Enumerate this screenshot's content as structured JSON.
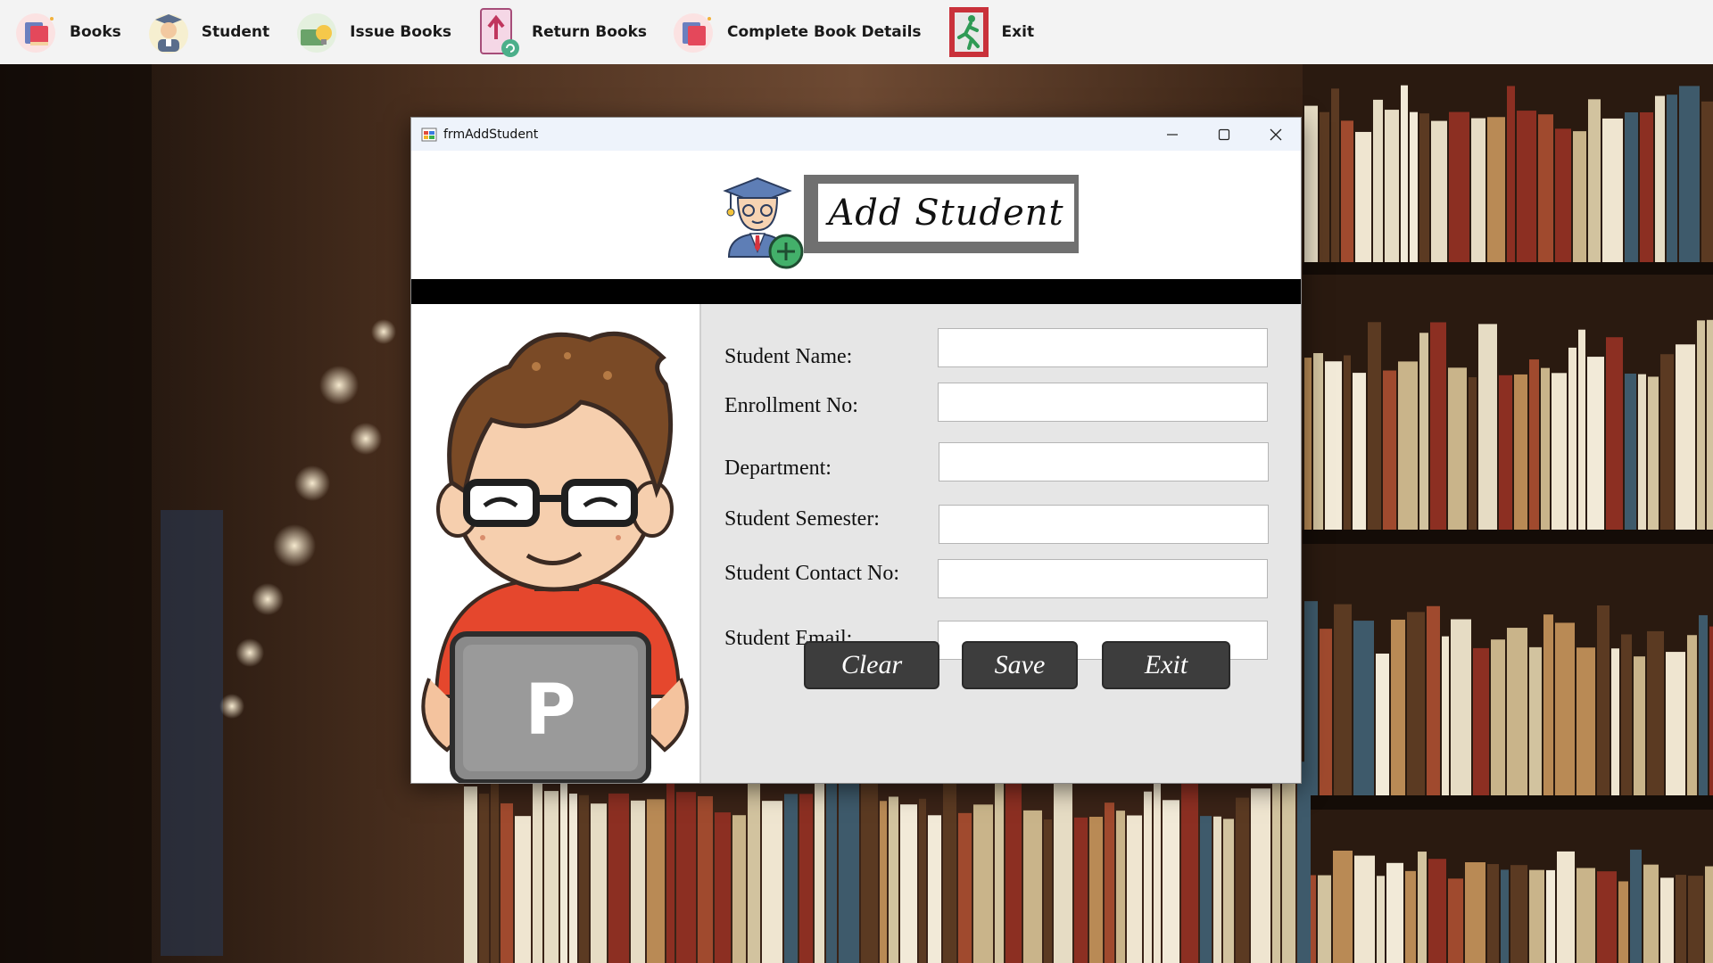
{
  "menubar": {
    "items": [
      {
        "label": "Books",
        "icon": "books-icon"
      },
      {
        "label": "Student",
        "icon": "student-icon"
      },
      {
        "label": "Issue Books",
        "icon": "issue-books-icon"
      },
      {
        "label": "Return Books",
        "icon": "return-books-icon"
      },
      {
        "label": "Complete Book Details",
        "icon": "book-details-icon"
      },
      {
        "label": "Exit",
        "icon": "exit-running-man-icon"
      }
    ]
  },
  "window": {
    "title": "frmAddStudent",
    "heading": "Add Student",
    "controls": [
      "minimize-icon",
      "maximize-icon",
      "close-icon"
    ]
  },
  "form": {
    "fields": [
      {
        "label": "Student Name:",
        "value": ""
      },
      {
        "label": "Enrollment No:",
        "value": ""
      },
      {
        "label": "Department:",
        "value": ""
      },
      {
        "label": "Student Semester:",
        "value": ""
      },
      {
        "label": "Student Contact No:",
        "value": ""
      },
      {
        "label": "Student Email:",
        "value": ""
      }
    ],
    "buttons": {
      "clear": "Clear",
      "save": "Save",
      "exit": "Exit"
    }
  },
  "illustration": {
    "laptop_letter": "P"
  },
  "colors": {
    "menubar_bg": "#f3f3f3",
    "titlebar_bg": "#eef3fb",
    "form_bg": "#e6e6e6",
    "button_bg": "#3d3d3d",
    "divider": "#000000",
    "heading_frame": "#707070"
  }
}
